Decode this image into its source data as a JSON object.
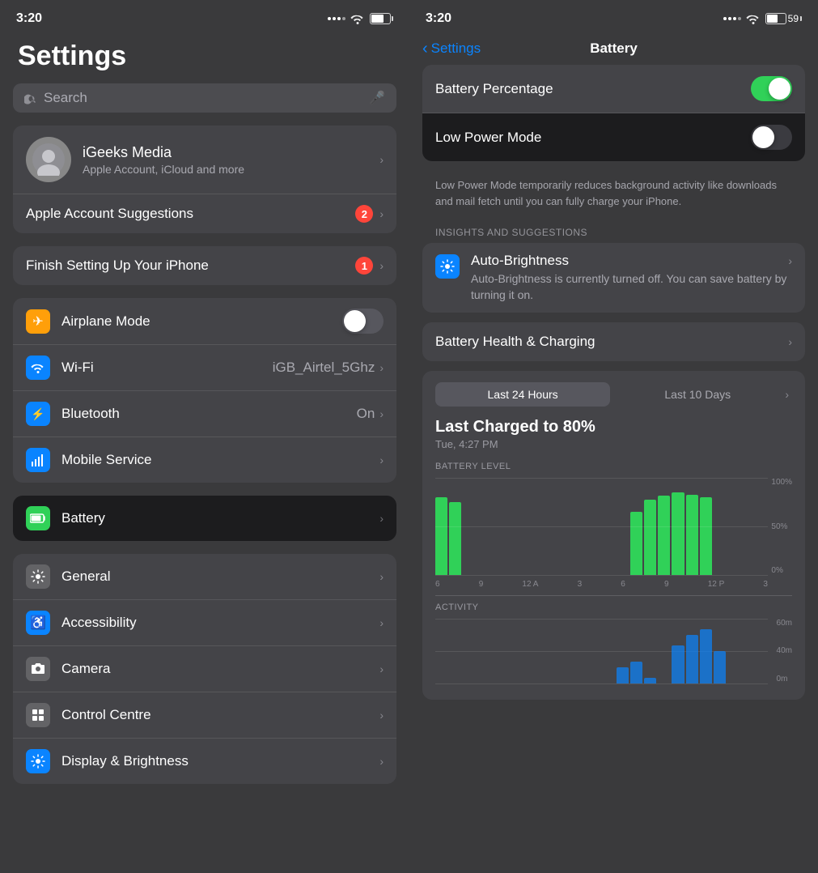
{
  "left": {
    "status": {
      "time": "3:20",
      "battery_pct": "59"
    },
    "title": "Settings",
    "search": {
      "placeholder": "Search"
    },
    "profile": {
      "name": "iGeeks Media",
      "subtitle": "Apple Account, iCloud and more"
    },
    "apple_account_row": {
      "label": "Apple Account Suggestions",
      "badge": "2"
    },
    "finish_row": {
      "label": "Finish Setting Up Your iPhone",
      "badge": "1"
    },
    "connectivity": [
      {
        "label": "Airplane Mode",
        "value": "",
        "toggle": true,
        "toggle_on": false,
        "icon_bg": "#ff9f0a",
        "icon": "✈"
      },
      {
        "label": "Wi-Fi",
        "value": "iGB_Airtel_5Ghz",
        "toggle": false,
        "icon_bg": "#0a84ff",
        "icon": "📶"
      },
      {
        "label": "Bluetooth",
        "value": "On",
        "toggle": false,
        "icon_bg": "#0a84ff",
        "icon": "⚡"
      },
      {
        "label": "Mobile Service",
        "value": "",
        "toggle": false,
        "icon_bg": "#0a84ff",
        "icon": "📡"
      }
    ],
    "battery_row": {
      "label": "Battery",
      "icon_bg": "#30d158"
    },
    "more_settings": [
      {
        "label": "General",
        "icon_bg": "#636366",
        "icon": "⚙"
      },
      {
        "label": "Accessibility",
        "icon_bg": "#0a84ff",
        "icon": "♿"
      },
      {
        "label": "Camera",
        "icon_bg": "#636366",
        "icon": "📷"
      },
      {
        "label": "Control Centre",
        "icon_bg": "#636366",
        "icon": "⊞"
      },
      {
        "label": "Display & Brightness",
        "icon_bg": "#0a84ff",
        "icon": "☀"
      }
    ]
  },
  "right": {
    "status": {
      "time": "3:20",
      "battery_pct": "59"
    },
    "nav": {
      "back_label": "Settings",
      "title": "Battery"
    },
    "battery_percentage_row": {
      "label": "Battery Percentage",
      "toggle_on": true
    },
    "low_power_row": {
      "label": "Low Power Mode",
      "toggle_on": false
    },
    "low_power_desc": "Low Power Mode temporarily reduces background activity like downloads and mail fetch until you can fully charge your iPhone.",
    "insights_label": "INSIGHTS AND SUGGESTIONS",
    "auto_brightness": {
      "label": "Auto-Brightness",
      "desc": "Auto-Brightness is currently turned off. You can save battery by turning it on.",
      "icon_bg": "#0a84ff"
    },
    "battery_health_row": {
      "label": "Battery Health & Charging"
    },
    "chart": {
      "tabs": [
        "Last 24 Hours",
        "Last 10 Days"
      ],
      "active_tab": 0,
      "title": "Last Charged to 80%",
      "subtitle": "Tue, 4:27 PM",
      "battery_level_label": "BATTERY LEVEL",
      "y_labels": [
        "100%",
        "50%",
        "0%"
      ],
      "x_labels": [
        "6",
        "9",
        "12 A",
        "3",
        "6",
        "9",
        "12 P",
        "3"
      ],
      "bars": [
        80,
        75,
        0,
        0,
        0,
        0,
        0,
        0,
        0,
        0,
        0,
        0,
        0,
        0,
        65,
        78,
        82,
        85,
        83,
        80,
        0,
        0,
        0,
        0
      ],
      "activity_label": "ACTIVITY",
      "activity_y_labels": [
        "60m",
        "40m",
        "0m"
      ],
      "activity_bars": [
        0,
        0,
        0,
        0,
        0,
        0,
        0,
        0,
        0,
        0,
        0,
        0,
        0,
        15,
        20,
        5,
        0,
        35,
        45,
        50,
        30,
        0,
        0,
        0
      ]
    }
  }
}
